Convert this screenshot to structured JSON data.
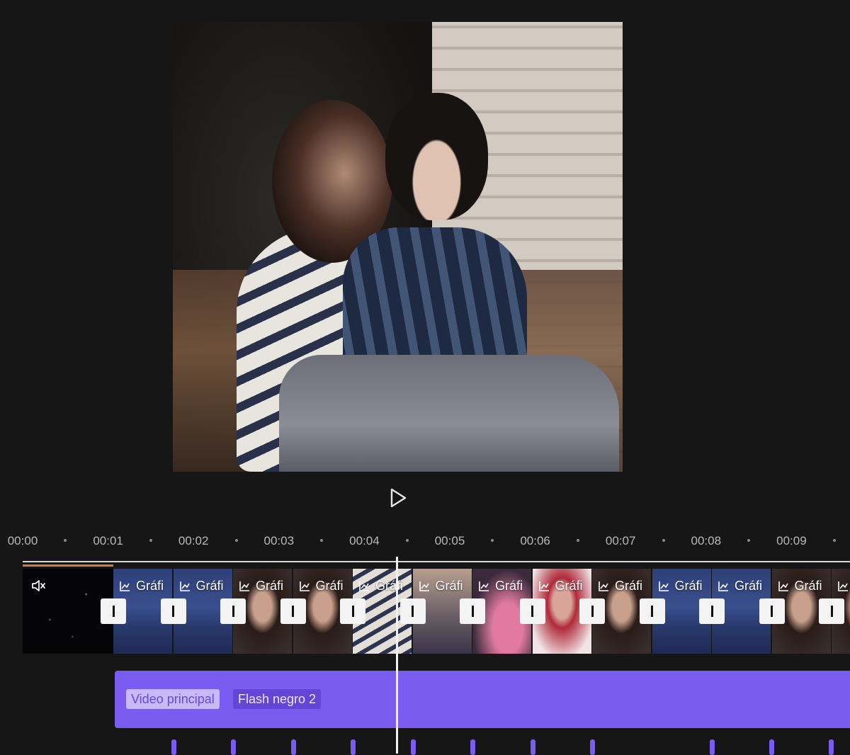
{
  "preview": {
    "description_icon": "video-preview"
  },
  "player": {
    "play_icon": "play-icon"
  },
  "ruler": {
    "labels": [
      "00:00",
      "00:01",
      "00:02",
      "00:03",
      "00:04",
      "00:05",
      "00:06",
      "00:07",
      "00:08",
      "00:09"
    ]
  },
  "video_track": {
    "mute_icon": "mute-icon",
    "effect_label": "Gráfi",
    "frames": [
      {
        "scene": "sea"
      },
      {
        "scene": "sea"
      },
      {
        "scene": "portrait"
      },
      {
        "scene": "portrait"
      },
      {
        "scene": "striped"
      },
      {
        "scene": "brick"
      },
      {
        "scene": "pink"
      },
      {
        "scene": "red"
      },
      {
        "scene": "portrait"
      },
      {
        "scene": "sea"
      },
      {
        "scene": "sea"
      },
      {
        "scene": "portrait"
      },
      {
        "scene": "portrait"
      }
    ]
  },
  "effect_track": {
    "tag_main": "Video principal",
    "tag_effect": "Flash negro 2"
  },
  "colors": {
    "accent": "#7a5cf0",
    "playhead": "#f2f2f2",
    "background": "#161617"
  }
}
